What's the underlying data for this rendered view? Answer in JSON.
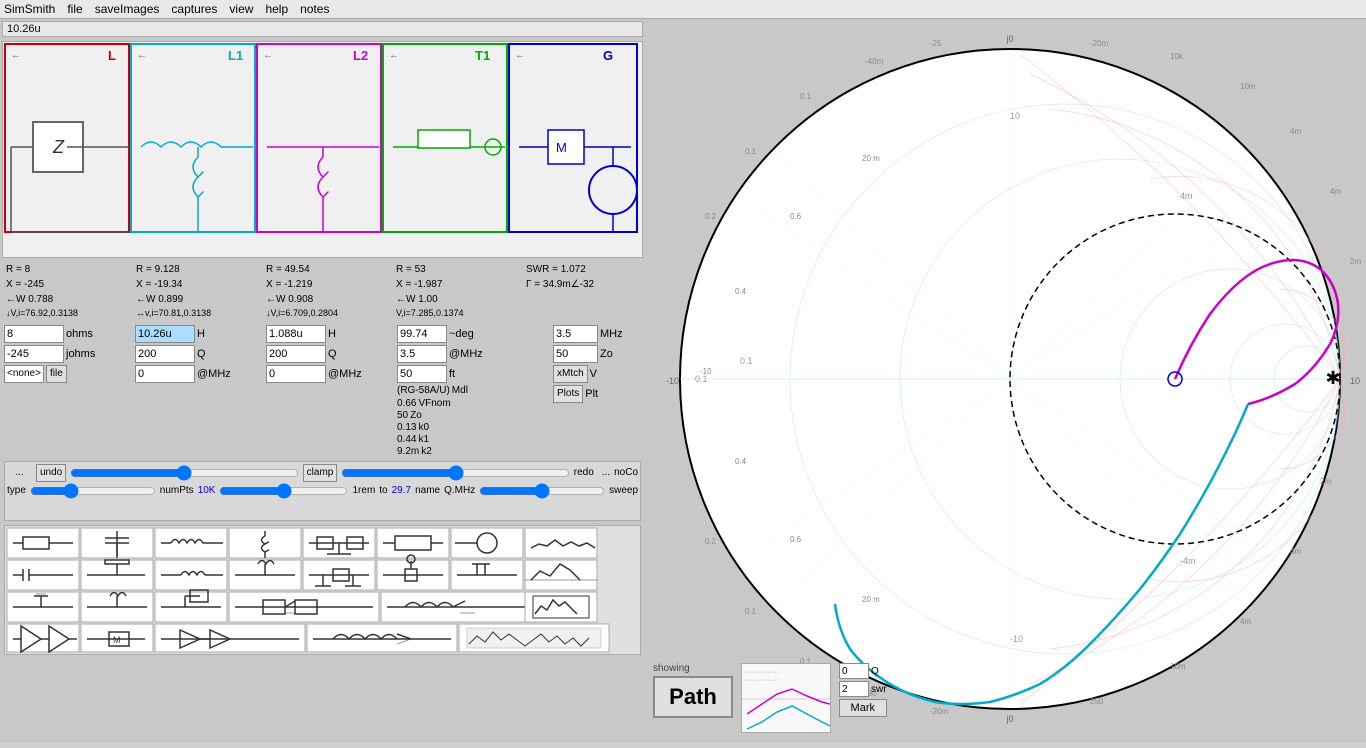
{
  "app": {
    "title": "SimSmith"
  },
  "menubar": {
    "items": [
      "SimSmith",
      "file",
      "saveImages",
      "captures",
      "view",
      "help",
      "notes"
    ]
  },
  "circuit": {
    "title": "10.26u",
    "sections": [
      {
        "id": "L",
        "label": "L",
        "color": "#cc0000",
        "arrow": "←",
        "R": "R = 8",
        "X": "X = -245",
        "W": "←W 0.788",
        "VI": "↓V,i=76.92,0.3138"
      },
      {
        "id": "L1",
        "label": "L1",
        "color": "#00aacc",
        "arrow": "←",
        "R": "R = 9.128",
        "X": "X = -19.34",
        "W": "←W 0.899",
        "VI": "↔v,i=70.81,0.3138"
      },
      {
        "id": "L2",
        "label": "L2",
        "color": "#cc00cc",
        "arrow": "←",
        "R": "R = 49.54",
        "X": "X = -1.219",
        "W": "←W 0.908",
        "VI": "↓V,i=6.709,0.2804"
      },
      {
        "id": "T1",
        "label": "T1",
        "color": "#00aa00",
        "arrow": "←",
        "R": "R = 53",
        "X": "X = -1.987",
        "W": "←W 1.00",
        "VI": "V,i=7.285,0.1374"
      },
      {
        "id": "G",
        "label": "G",
        "color": "#0000cc",
        "arrow": "←",
        "R": "SWR = 1.072",
        "X": "Γ = 34.9m∠-32",
        "W": "",
        "VI": ""
      }
    ]
  },
  "inputs": {
    "col1": {
      "val1": "8",
      "unit1": "ohms",
      "val2": "-245",
      "unit2": "johms",
      "val3": "<none>",
      "unit3": "file"
    },
    "col2": {
      "val1": "10.26u",
      "unit1": "H",
      "val2": "200",
      "unit2": "Q",
      "val3": "0",
      "unit3": "@MHz"
    },
    "col3": {
      "val1": "1.088u",
      "unit1": "H",
      "val2": "200",
      "unit2": "Q",
      "val3": "0",
      "unit3": "@MHz"
    },
    "col4": {
      "val1": "99.74",
      "unit1": "~deg",
      "val2": "3.5",
      "unit2": "@MHz",
      "val3": "50",
      "unit3": "ft",
      "val4": "(RG-58A/U)",
      "unit4": "Mdl"
    },
    "col5": {
      "val1": "3.5",
      "unit1": "MHz",
      "val2": "50",
      "unit2": "Zo",
      "val3": "xMtch",
      "unit3": "V",
      "val4": "Plots",
      "unit4": "Plt"
    }
  },
  "transmission_line": {
    "VFnom": "0.66",
    "Zo": "50",
    "k0": "0.13",
    "k1": "0.44",
    "k2": "9.2m",
    "labels": [
      "VFnom",
      "Zo",
      "k0",
      "k1",
      "k2"
    ]
  },
  "bottom_panel": {
    "showing_label": "showing",
    "path_label": "Path",
    "Q_label": "Q",
    "Q_value": "0",
    "swr_label": "swr",
    "swr_value": "2",
    "mark_label": "Mark"
  },
  "slider": {
    "rows": [
      {
        "left": "undo",
        "right": "redo",
        "label": "clamp",
        "value": 50,
        "extra": "noCo"
      },
      {
        "left": "type",
        "label": "numPts",
        "value1": "10K",
        "value2": "1rem",
        "extra": "to",
        "value3": "29.7",
        "label2": "name",
        "label3": "Q.MHz",
        "label4": "sweep"
      }
    ]
  }
}
